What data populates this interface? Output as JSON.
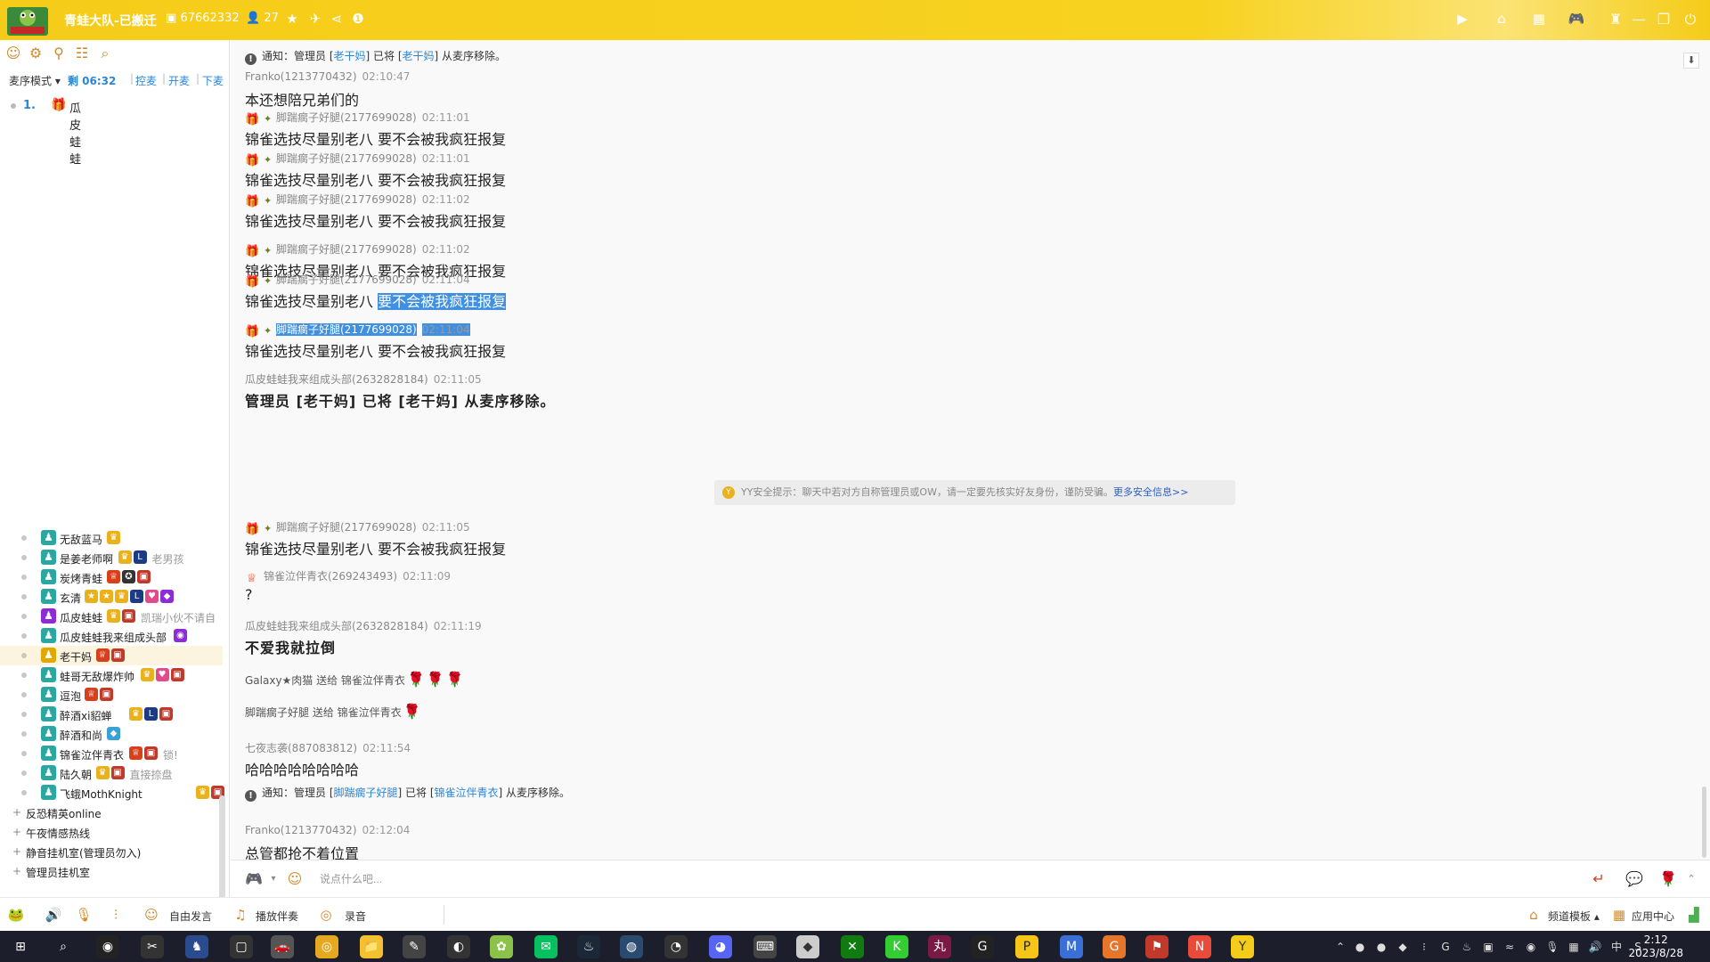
{
  "titlebar": {
    "channel_name": "青蛙大队-已搬迁",
    "channel_id": "67662332",
    "online_count": "27",
    "accent_color": "#f5cc19"
  },
  "left_panel": {
    "mode_label": "麦序模式 ▾",
    "remaining_label": "剩 06:32",
    "actions": [
      "控麦",
      "开麦",
      "下麦"
    ],
    "queue": [
      {
        "num": "1.",
        "name": "瓜皮蛙蛙"
      }
    ],
    "users": [
      {
        "name": "无敌蓝马",
        "badges": [
          "crown"
        ],
        "note": "",
        "tag_color": "#2aa7a0"
      },
      {
        "name": "是姜老师啊",
        "badges": [
          "crown",
          "L"
        ],
        "note": "老男孩",
        "tag_color": "#2aa7a0"
      },
      {
        "name": "炭烤青蛙",
        "badges": [
          "wing",
          "medal",
          "gift"
        ],
        "note": "",
        "tag_color": "#2aa7a0"
      },
      {
        "name": "玄清",
        "badges": [
          "star",
          "star",
          "crown",
          "L",
          "heart",
          "gem"
        ],
        "note": "",
        "tag_color": "#2aa7a0"
      },
      {
        "name": "瓜皮蛙蛙",
        "badges": [
          "crown",
          "gift"
        ],
        "note": "凯瑞小伙不请自",
        "tag_color": "#8e2bd6"
      },
      {
        "name": "瓜皮蛙蛙我来组成头部",
        "badges": [
          "purple"
        ],
        "note": "",
        "tag_color": "#2aa7a0"
      },
      {
        "name": "老干妈",
        "badges": [
          "wing",
          "gift"
        ],
        "note": "",
        "tag_color": "#e0a800"
      },
      {
        "name": "蛙哥无敌爆炸帅",
        "badges": [
          "crown",
          "heart",
          "gift"
        ],
        "note": "",
        "tag_color": "#2aa7a0"
      },
      {
        "name": "逗泡",
        "badges": [
          "wing",
          "gift"
        ],
        "note": "",
        "tag_color": "#2aa7a0"
      },
      {
        "name": "醉酒xi貂蝉",
        "badges": [
          "crown",
          "L",
          "gift"
        ],
        "note": "",
        "tag_color": "#2aa7a0"
      },
      {
        "name": "醉酒和尚",
        "badges": [
          "diamond"
        ],
        "note": "",
        "tag_color": "#2aa7a0"
      },
      {
        "name": "锦雀泣伴青衣",
        "badges": [
          "wing",
          "gift"
        ],
        "note": "锁!",
        "tag_color": "#2aa7a0"
      },
      {
        "name": "陆久朝",
        "badges": [
          "crown",
          "gift"
        ],
        "note": "直接捺盘",
        "tag_color": "#2aa7a0"
      },
      {
        "name": "飞蛾MothKnight",
        "badges": [
          "crown",
          "gift"
        ],
        "note": "",
        "tag_color": "#2aa7a0"
      }
    ],
    "sub_channels": [
      "反恐精英online",
      "午夜情感热线",
      "静音挂机室(管理员勿入)",
      "管理员挂机室"
    ]
  },
  "chat": {
    "messages": [
      {
        "kind": "notice",
        "parts": [
          "通知：管理员 [",
          "老干妈",
          "] 已将 [",
          "老干妈",
          "] 从麦序移除。"
        ]
      },
      {
        "kind": "msg",
        "sender": "Franko(1213770432)",
        "time": "02:10:47",
        "text": "本还想陪兄弟们的"
      },
      {
        "kind": "msg",
        "sender": "脚踹瘸子好腿(2177699028)",
        "time": "02:11:01",
        "text": "锦雀选技尽量别老八  要不会被我疯狂报复"
      },
      {
        "kind": "msg",
        "sender": "脚踹瘸子好腿(2177699028)",
        "time": "02:11:01",
        "text": "锦雀选技尽量别老八  要不会被我疯狂报复"
      },
      {
        "kind": "msg",
        "sender": "脚踹瘸子好腿(2177699028)",
        "time": "02:11:02",
        "text": "锦雀选技尽量别老八  要不会被我疯狂报复"
      },
      {
        "kind": "msg",
        "sender": "脚踹瘸子好腿(2177699028)",
        "time": "02:11:02",
        "text": "锦雀选技尽量别老八  要不会被我疯狂报复"
      },
      {
        "kind": "msg",
        "sender": "脚踹瘸子好腿(2177699028)",
        "time": "02:11:04",
        "text_a": "锦雀选技尽量别老八  ",
        "text_b": "要不会被我疯狂报复"
      },
      {
        "kind": "msg",
        "sender": "脚踹瘸子好腿(2177699028)",
        "time": "02:11:04",
        "text": "锦雀选技尽量别老八  要不会被我疯狂报复"
      },
      {
        "kind": "msg",
        "sender": "瓜皮蛙蛙我来组成头部(2632828184)",
        "time": "02:11:05",
        "text": "管理员 [老干妈] 已将 [老干妈] 从麦序移除。"
      },
      {
        "kind": "security",
        "text": "YY安全提示：聊天中若对方自称管理员或OW，请一定要先核实好友身份，谨防受骗。",
        "link": "更多安全信息>>"
      },
      {
        "kind": "msg",
        "sender": "脚踹瘸子好腿(2177699028)",
        "time": "02:11:05",
        "text": "锦雀选技尽量别老八  要不会被我疯狂报复"
      },
      {
        "kind": "msg",
        "sender": "锦雀泣伴青衣(269243493)",
        "time": "02:11:09",
        "text": "?"
      },
      {
        "kind": "msg",
        "sender": "瓜皮蛙蛙我来组成头部(2632828184)",
        "time": "02:11:19",
        "text": "不爱我就拉倒"
      },
      {
        "kind": "gift",
        "text": "Galaxy★肉猫 送给 锦雀泣伴青衣"
      },
      {
        "kind": "gift",
        "text": "脚踹瘸子好腿 送给 锦雀泣伴青衣"
      },
      {
        "kind": "msg",
        "sender": "七夜志袭(887083812)",
        "time": "02:11:54",
        "text": "哈哈哈哈哈哈哈哈"
      },
      {
        "kind": "notice",
        "parts": [
          "通知：管理员 [",
          "脚踹瘸子好腿",
          "] 已将 [",
          "锦雀泣伴青衣",
          "] 从麦序移除。"
        ]
      },
      {
        "kind": "msg",
        "sender": "Franko(1213770432)",
        "time": "02:12:04",
        "text": "总管都抢不着位置"
      }
    ]
  },
  "input": {
    "placeholder": "说点什么吧..."
  },
  "bottom_bar": {
    "free_speak": "自由发言",
    "play_music": "播放伴奏",
    "record": "录音",
    "template": "频道模板 ▴",
    "app_center": "应用中心"
  },
  "taskbar": {
    "time": "2:12",
    "date": "2023/8/28"
  }
}
